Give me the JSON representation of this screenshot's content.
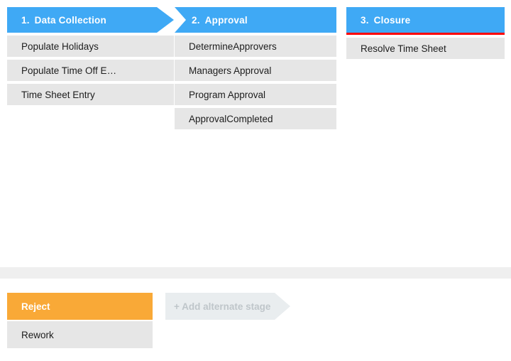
{
  "colors": {
    "stage_header_bg": "#3fa9f5",
    "stage_item_bg": "#e6e6e6",
    "active_alt_bg": "#f9a937",
    "closure_rule": "#ff0000",
    "add_stage_bg": "#e9edef",
    "divider_band": "#efefef"
  },
  "stages": [
    {
      "number": "1.",
      "title": "Data Collection",
      "items": [
        "Populate Holidays",
        "Populate Time Off E…",
        "Time Sheet Entry"
      ]
    },
    {
      "number": "2.",
      "title": "Approval",
      "items": [
        "DetermineApprovers",
        "Managers Approval",
        "Program Approval",
        "ApprovalCompleted"
      ]
    },
    {
      "number": "3.",
      "title": "Closure",
      "items": [
        "Resolve Time Sheet"
      ]
    }
  ],
  "alternate": {
    "items": [
      {
        "label": "Reject",
        "state": "active"
      },
      {
        "label": "Rework",
        "state": "plain"
      }
    ],
    "add_label": "+ Add alternate stage"
  }
}
